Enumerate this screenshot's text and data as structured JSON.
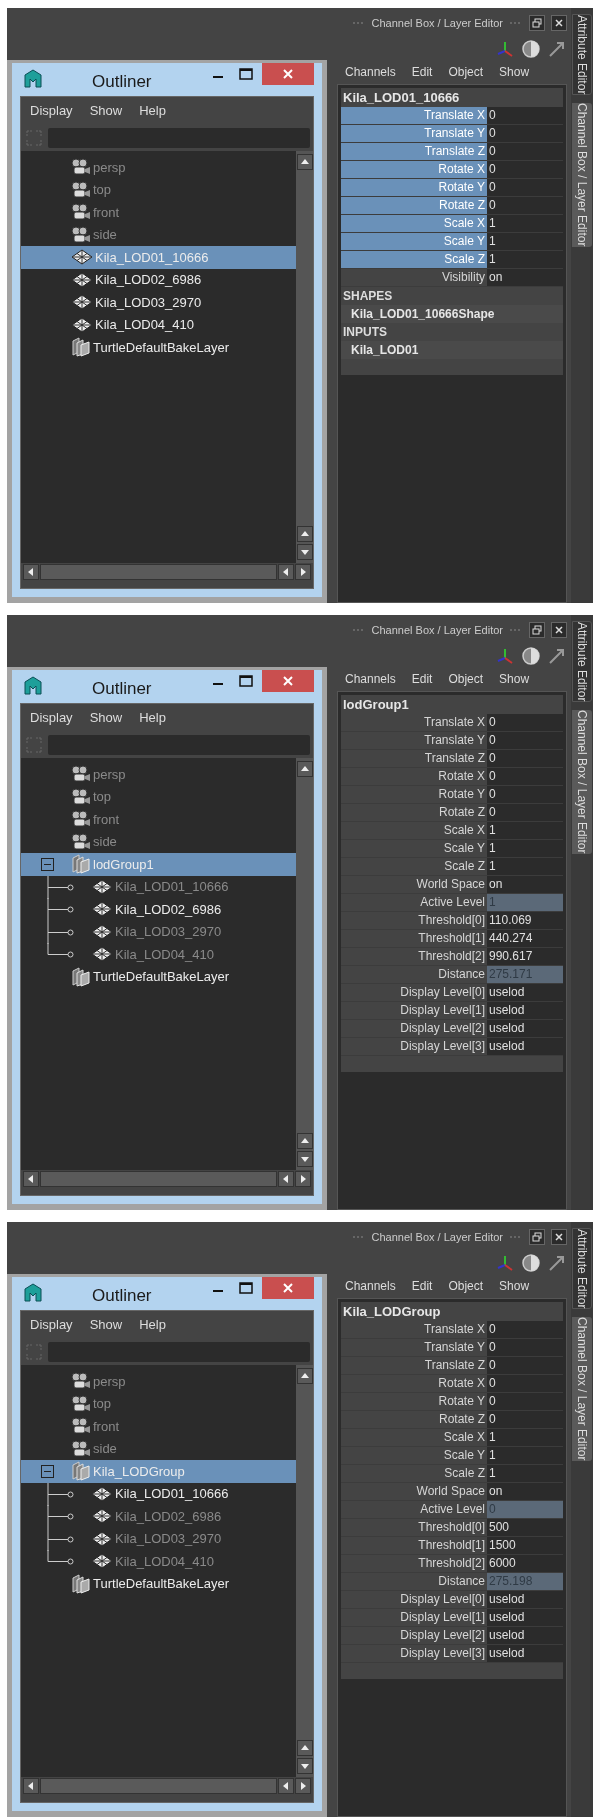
{
  "panels": [
    {
      "header": {
        "title": "Channel Box / Layer Editor"
      },
      "side_tabs": [
        {
          "label": "Attribute Editor",
          "selected": false
        },
        {
          "label": "Channel Box / Layer Editor",
          "selected": true
        }
      ],
      "outliner": {
        "title": "Outliner",
        "menu": [
          "Display",
          "Show",
          "Help"
        ],
        "tree": [
          {
            "label": "persp",
            "kind": "camera",
            "hidden": true,
            "selected": false
          },
          {
            "label": "top",
            "kind": "camera",
            "hidden": true,
            "selected": false
          },
          {
            "label": "front",
            "kind": "camera",
            "hidden": true,
            "selected": false
          },
          {
            "label": "side",
            "kind": "camera",
            "hidden": true,
            "selected": false
          },
          {
            "label": "Kila_LOD01_10666",
            "kind": "mesh",
            "hidden": false,
            "selected": true
          },
          {
            "label": "Kila_LOD02_6986",
            "kind": "mesh",
            "hidden": false,
            "selected": false
          },
          {
            "label": "Kila_LOD03_2970",
            "kind": "mesh",
            "hidden": false,
            "selected": false
          },
          {
            "label": "Kila_LOD04_410",
            "kind": "mesh",
            "hidden": false,
            "selected": false
          },
          {
            "label": "TurtleDefaultBakeLayer",
            "kind": "layer",
            "hidden": false,
            "selected": false
          }
        ]
      },
      "channel_box": {
        "menu": [
          "Channels",
          "Edit",
          "Object",
          "Show"
        ],
        "node": "Kila_LOD01_10666",
        "channels": [
          {
            "label": "Translate X",
            "value": "0",
            "selected": true,
            "connected": false
          },
          {
            "label": "Translate Y",
            "value": "0",
            "selected": true,
            "connected": false
          },
          {
            "label": "Translate Z",
            "value": "0",
            "selected": true,
            "connected": false
          },
          {
            "label": "Rotate X",
            "value": "0",
            "selected": true,
            "connected": false
          },
          {
            "label": "Rotate Y",
            "value": "0",
            "selected": true,
            "connected": false
          },
          {
            "label": "Rotate Z",
            "value": "0",
            "selected": true,
            "connected": false
          },
          {
            "label": "Scale X",
            "value": "1",
            "selected": true,
            "connected": false
          },
          {
            "label": "Scale Y",
            "value": "1",
            "selected": true,
            "connected": false
          },
          {
            "label": "Scale Z",
            "value": "1",
            "selected": true,
            "connected": false
          },
          {
            "label": "Visibility",
            "value": "on",
            "selected": false,
            "connected": false
          }
        ],
        "sections": [
          {
            "heading": "SHAPES",
            "items": [
              "Kila_LOD01_10666Shape"
            ]
          },
          {
            "heading": "INPUTS",
            "items": [
              "Kila_LOD01"
            ]
          }
        ]
      }
    },
    {
      "header": {
        "title": "Channel Box / Layer Editor"
      },
      "side_tabs": [
        {
          "label": "Attribute Editor",
          "selected": false
        },
        {
          "label": "Channel Box / Layer Editor",
          "selected": true
        }
      ],
      "outliner": {
        "title": "Outliner",
        "menu": [
          "Display",
          "Show",
          "Help"
        ],
        "tree": [
          {
            "label": "persp",
            "kind": "camera",
            "hidden": true,
            "selected": false
          },
          {
            "label": "top",
            "kind": "camera",
            "hidden": true,
            "selected": false
          },
          {
            "label": "front",
            "kind": "camera",
            "hidden": true,
            "selected": false
          },
          {
            "label": "side",
            "kind": "camera",
            "hidden": true,
            "selected": false
          },
          {
            "label": "lodGroup1",
            "kind": "group",
            "hidden": false,
            "selected": true,
            "expanded": true,
            "children": [
              {
                "label": "Kila_LOD01_10666",
                "kind": "mesh",
                "hidden": true,
                "selected": false
              },
              {
                "label": "Kila_LOD02_6986",
                "kind": "mesh",
                "hidden": false,
                "selected": false
              },
              {
                "label": "Kila_LOD03_2970",
                "kind": "mesh",
                "hidden": true,
                "selected": false
              },
              {
                "label": "Kila_LOD04_410",
                "kind": "mesh",
                "hidden": true,
                "selected": false
              }
            ]
          },
          {
            "label": "TurtleDefaultBakeLayer",
            "kind": "layer",
            "hidden": false,
            "selected": false
          }
        ]
      },
      "channel_box": {
        "menu": [
          "Channels",
          "Edit",
          "Object",
          "Show"
        ],
        "node": "lodGroup1",
        "channels": [
          {
            "label": "Translate X",
            "value": "0",
            "selected": false,
            "connected": false
          },
          {
            "label": "Translate Y",
            "value": "0",
            "selected": false,
            "connected": false
          },
          {
            "label": "Translate Z",
            "value": "0",
            "selected": false,
            "connected": false
          },
          {
            "label": "Rotate X",
            "value": "0",
            "selected": false,
            "connected": false
          },
          {
            "label": "Rotate Y",
            "value": "0",
            "selected": false,
            "connected": false
          },
          {
            "label": "Rotate Z",
            "value": "0",
            "selected": false,
            "connected": false
          },
          {
            "label": "Scale X",
            "value": "1",
            "selected": false,
            "connected": false
          },
          {
            "label": "Scale Y",
            "value": "1",
            "selected": false,
            "connected": false
          },
          {
            "label": "Scale Z",
            "value": "1",
            "selected": false,
            "connected": false
          },
          {
            "label": "World Space",
            "value": "on",
            "selected": false,
            "connected": false
          },
          {
            "label": "Active Level",
            "value": "1",
            "selected": false,
            "connected": true
          },
          {
            "label": "Threshold[0]",
            "value": "110.069",
            "selected": false,
            "connected": false
          },
          {
            "label": "Threshold[1]",
            "value": "440.274",
            "selected": false,
            "connected": false
          },
          {
            "label": "Threshold[2]",
            "value": "990.617",
            "selected": false,
            "connected": false
          },
          {
            "label": "Distance",
            "value": "275.171",
            "selected": false,
            "connected": true
          },
          {
            "label": "Display Level[0]",
            "value": "uselod",
            "selected": false,
            "connected": false
          },
          {
            "label": "Display Level[1]",
            "value": "uselod",
            "selected": false,
            "connected": false
          },
          {
            "label": "Display Level[2]",
            "value": "uselod",
            "selected": false,
            "connected": false
          },
          {
            "label": "Display Level[3]",
            "value": "uselod",
            "selected": false,
            "connected": false
          }
        ]
      }
    },
    {
      "header": {
        "title": "Channel Box / Layer Editor"
      },
      "side_tabs": [
        {
          "label": "Attribute Editor",
          "selected": false
        },
        {
          "label": "Channel Box / Layer Editor",
          "selected": true
        }
      ],
      "outliner": {
        "title": "Outliner",
        "menu": [
          "Display",
          "Show",
          "Help"
        ],
        "tree": [
          {
            "label": "persp",
            "kind": "camera",
            "hidden": true,
            "selected": false
          },
          {
            "label": "top",
            "kind": "camera",
            "hidden": true,
            "selected": false
          },
          {
            "label": "front",
            "kind": "camera",
            "hidden": true,
            "selected": false
          },
          {
            "label": "side",
            "kind": "camera",
            "hidden": true,
            "selected": false
          },
          {
            "label": "Kila_LODGroup",
            "kind": "group",
            "hidden": false,
            "selected": true,
            "expanded": true,
            "children": [
              {
                "label": "Kila_LOD01_10666",
                "kind": "mesh",
                "hidden": false,
                "selected": false
              },
              {
                "label": "Kila_LOD02_6986",
                "kind": "mesh",
                "hidden": true,
                "selected": false
              },
              {
                "label": "Kila_LOD03_2970",
                "kind": "mesh",
                "hidden": true,
                "selected": false
              },
              {
                "label": "Kila_LOD04_410",
                "kind": "mesh",
                "hidden": true,
                "selected": false
              }
            ]
          },
          {
            "label": "TurtleDefaultBakeLayer",
            "kind": "layer",
            "hidden": false,
            "selected": false
          }
        ]
      },
      "channel_box": {
        "menu": [
          "Channels",
          "Edit",
          "Object",
          "Show"
        ],
        "node": "Kila_LODGroup",
        "channels": [
          {
            "label": "Translate X",
            "value": "0",
            "selected": false,
            "connected": false
          },
          {
            "label": "Translate Y",
            "value": "0",
            "selected": false,
            "connected": false
          },
          {
            "label": "Translate Z",
            "value": "0",
            "selected": false,
            "connected": false
          },
          {
            "label": "Rotate X",
            "value": "0",
            "selected": false,
            "connected": false
          },
          {
            "label": "Rotate Y",
            "value": "0",
            "selected": false,
            "connected": false
          },
          {
            "label": "Rotate Z",
            "value": "0",
            "selected": false,
            "connected": false
          },
          {
            "label": "Scale X",
            "value": "1",
            "selected": false,
            "connected": false
          },
          {
            "label": "Scale Y",
            "value": "1",
            "selected": false,
            "connected": false
          },
          {
            "label": "Scale Z",
            "value": "1",
            "selected": false,
            "connected": false
          },
          {
            "label": "World Space",
            "value": "on",
            "selected": false,
            "connected": false
          },
          {
            "label": "Active Level",
            "value": "0",
            "selected": false,
            "connected": true
          },
          {
            "label": "Threshold[0]",
            "value": "500",
            "selected": false,
            "connected": false
          },
          {
            "label": "Threshold[1]",
            "value": "1500",
            "selected": false,
            "connected": false
          },
          {
            "label": "Threshold[2]",
            "value": "6000",
            "selected": false,
            "connected": false
          },
          {
            "label": "Distance",
            "value": "275.198",
            "selected": false,
            "connected": true
          },
          {
            "label": "Display Level[0]",
            "value": "uselod",
            "selected": false,
            "connected": false
          },
          {
            "label": "Display Level[1]",
            "value": "uselod",
            "selected": false,
            "connected": false
          },
          {
            "label": "Display Level[2]",
            "value": "uselod",
            "selected": false,
            "connected": false
          },
          {
            "label": "Display Level[3]",
            "value": "uselod",
            "selected": false,
            "connected": false
          }
        ]
      }
    }
  ]
}
